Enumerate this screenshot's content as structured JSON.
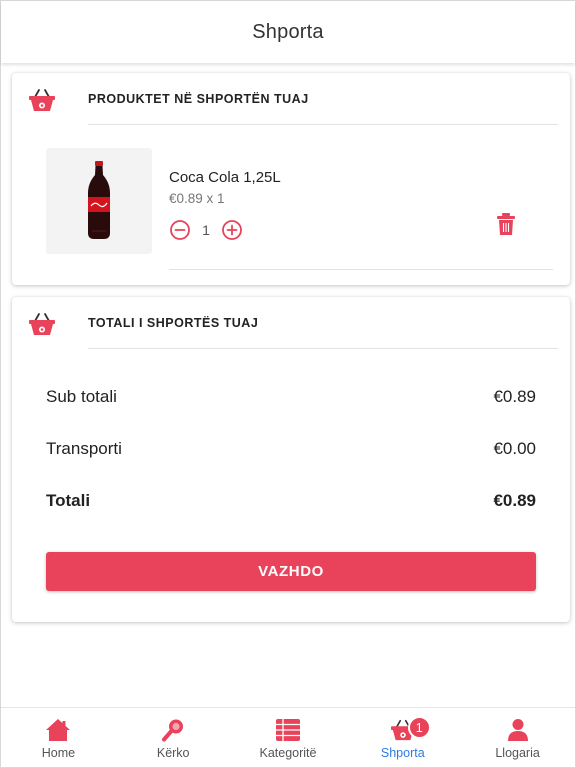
{
  "header": {
    "title": "Shporta"
  },
  "cart": {
    "section_title": "PRODUKTET NË SHPORTËN TUAJ",
    "items": [
      {
        "name": "Coca Cola 1,25L",
        "price_line": "€0.89 x 1",
        "quantity": "1"
      }
    ]
  },
  "totals": {
    "section_title": "TOTALI I SHPORTËS TUAJ",
    "subtotal_label": "Sub totali",
    "subtotal_value": "€0.89",
    "shipping_label": "Transporti",
    "shipping_value": "€0.00",
    "total_label": "Totali",
    "total_value": "€0.89",
    "continue_label": "VAZHDO"
  },
  "tabbar": {
    "items": [
      {
        "label": "Home",
        "icon": "home-icon"
      },
      {
        "label": "Kërko",
        "icon": "search-icon"
      },
      {
        "label": "Kategoritë",
        "icon": "categories-icon"
      },
      {
        "label": "Shporta",
        "icon": "basket-icon",
        "badge": "1",
        "active": true
      },
      {
        "label": "Llogaria",
        "icon": "account-icon"
      }
    ]
  },
  "colors": {
    "accent": "#e8435a",
    "active_tab": "#2e7ce0"
  }
}
